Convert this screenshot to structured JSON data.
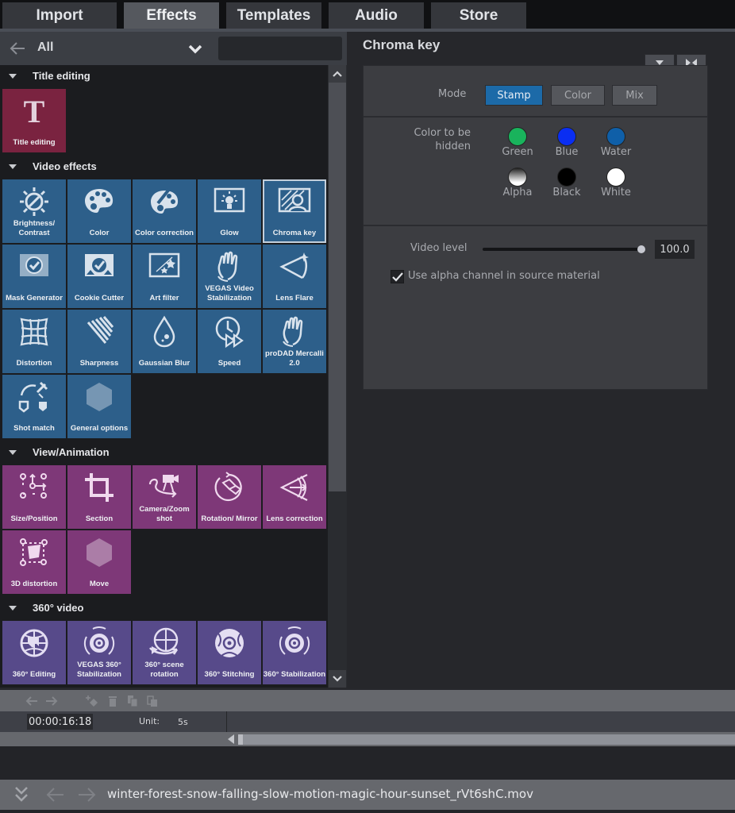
{
  "tabs": [
    {
      "label": "Import",
      "active": false
    },
    {
      "label": "Effects",
      "active": true
    },
    {
      "label": "Templates",
      "active": false
    },
    {
      "label": "Audio",
      "active": false
    },
    {
      "label": "Store",
      "active": false
    }
  ],
  "browser": {
    "filter_label": "All",
    "search_value": "",
    "sections": [
      {
        "label": "Title editing",
        "color": "#7a2340",
        "items": [
          {
            "label": "Title editing",
            "icon": "title-t-icon"
          }
        ]
      },
      {
        "label": "Video effects",
        "color": "#2d5f8a",
        "items": [
          {
            "label": "Brightness/ Contrast",
            "icon": "sun-icon"
          },
          {
            "label": "Color",
            "icon": "palette-icon"
          },
          {
            "label": "Color correction",
            "icon": "palette-pen-icon"
          },
          {
            "label": "Glow",
            "icon": "lightbulb-icon"
          },
          {
            "label": "Chroma key",
            "icon": "chroma-person-icon",
            "selected": true
          },
          {
            "label": "Mask Generator",
            "icon": "mask-icon"
          },
          {
            "label": "Cookie Cutter",
            "icon": "cookie-cutter-icon"
          },
          {
            "label": "Art filter",
            "icon": "art-stars-icon"
          },
          {
            "label": "VEGAS Video Stabilization",
            "icon": "hand-icon"
          },
          {
            "label": "Lens Flare",
            "icon": "lens-flare-icon"
          },
          {
            "label": "Distortion",
            "icon": "grid-warp-icon"
          },
          {
            "label": "Sharpness",
            "icon": "sharpness-icon"
          },
          {
            "label": "Gaussian Blur",
            "icon": "drop-icon"
          },
          {
            "label": "Speed",
            "icon": "clock-fastforward-icon"
          },
          {
            "label": "proDAD Mercalli 2.0",
            "icon": "hand-icon"
          },
          {
            "label": "Shot match",
            "icon": "eyedropper-icon"
          },
          {
            "label": "General options",
            "icon": "hexagon-icon"
          }
        ]
      },
      {
        "label": "View/Animation",
        "color": "#7e3878",
        "items": [
          {
            "label": "Size/Position",
            "icon": "move-points-icon"
          },
          {
            "label": "Section",
            "icon": "crop-icon"
          },
          {
            "label": "Camera/Zoom shot",
            "icon": "camera-path-icon"
          },
          {
            "label": "Rotation/ Mirror",
            "icon": "rotate-icon"
          },
          {
            "label": "Lens correction",
            "icon": "lens-icon"
          },
          {
            "label": "3D distortion",
            "icon": "3d-distort-icon"
          },
          {
            "label": "Move",
            "icon": "hexagon-icon"
          }
        ]
      },
      {
        "label": "360° video",
        "color": "#574a8a",
        "items": [
          {
            "label": "360° Editing",
            "icon": "globe-icon"
          },
          {
            "label": "VEGAS 360° Stabilization",
            "icon": "360-stab-icon"
          },
          {
            "label": "360° scene rotation",
            "icon": "globe-rotate-icon"
          },
          {
            "label": "360° Stitching",
            "icon": "stitch-ball-icon"
          },
          {
            "label": "360° Stabilization",
            "icon": "360-stab-icon"
          }
        ]
      }
    ]
  },
  "chroma": {
    "title": "Chroma key",
    "mode_label": "Mode",
    "modes": [
      {
        "label": "Stamp",
        "active": true
      },
      {
        "label": "Color",
        "active": false
      },
      {
        "label": "Mix",
        "active": false
      }
    ],
    "color_label_line1": "Color to be",
    "color_label_line2": "hidden",
    "colors": [
      {
        "label": "Green",
        "hex": "#19b35c"
      },
      {
        "label": "Blue",
        "hex": "#0a2ef2"
      },
      {
        "label": "Water",
        "hex": "#0f5fa8"
      },
      {
        "label": "Alpha",
        "hex": "gradient"
      },
      {
        "label": "Black",
        "hex": "#000000"
      },
      {
        "label": "White",
        "hex": "#ffffff"
      }
    ],
    "video_level_label": "Video level",
    "video_level_value": "100.0",
    "video_level_fraction": 1.0,
    "alpha_checkbox_label": "Use alpha channel in source material",
    "alpha_checked": true
  },
  "timeline": {
    "timecode": "00:00:16:18",
    "unit_label": "Unit:",
    "unit_value": "5s"
  },
  "status": {
    "filename": "winter-forest-snow-falling-slow-motion-magic-hour-sunset_rVt6shC.mov"
  }
}
